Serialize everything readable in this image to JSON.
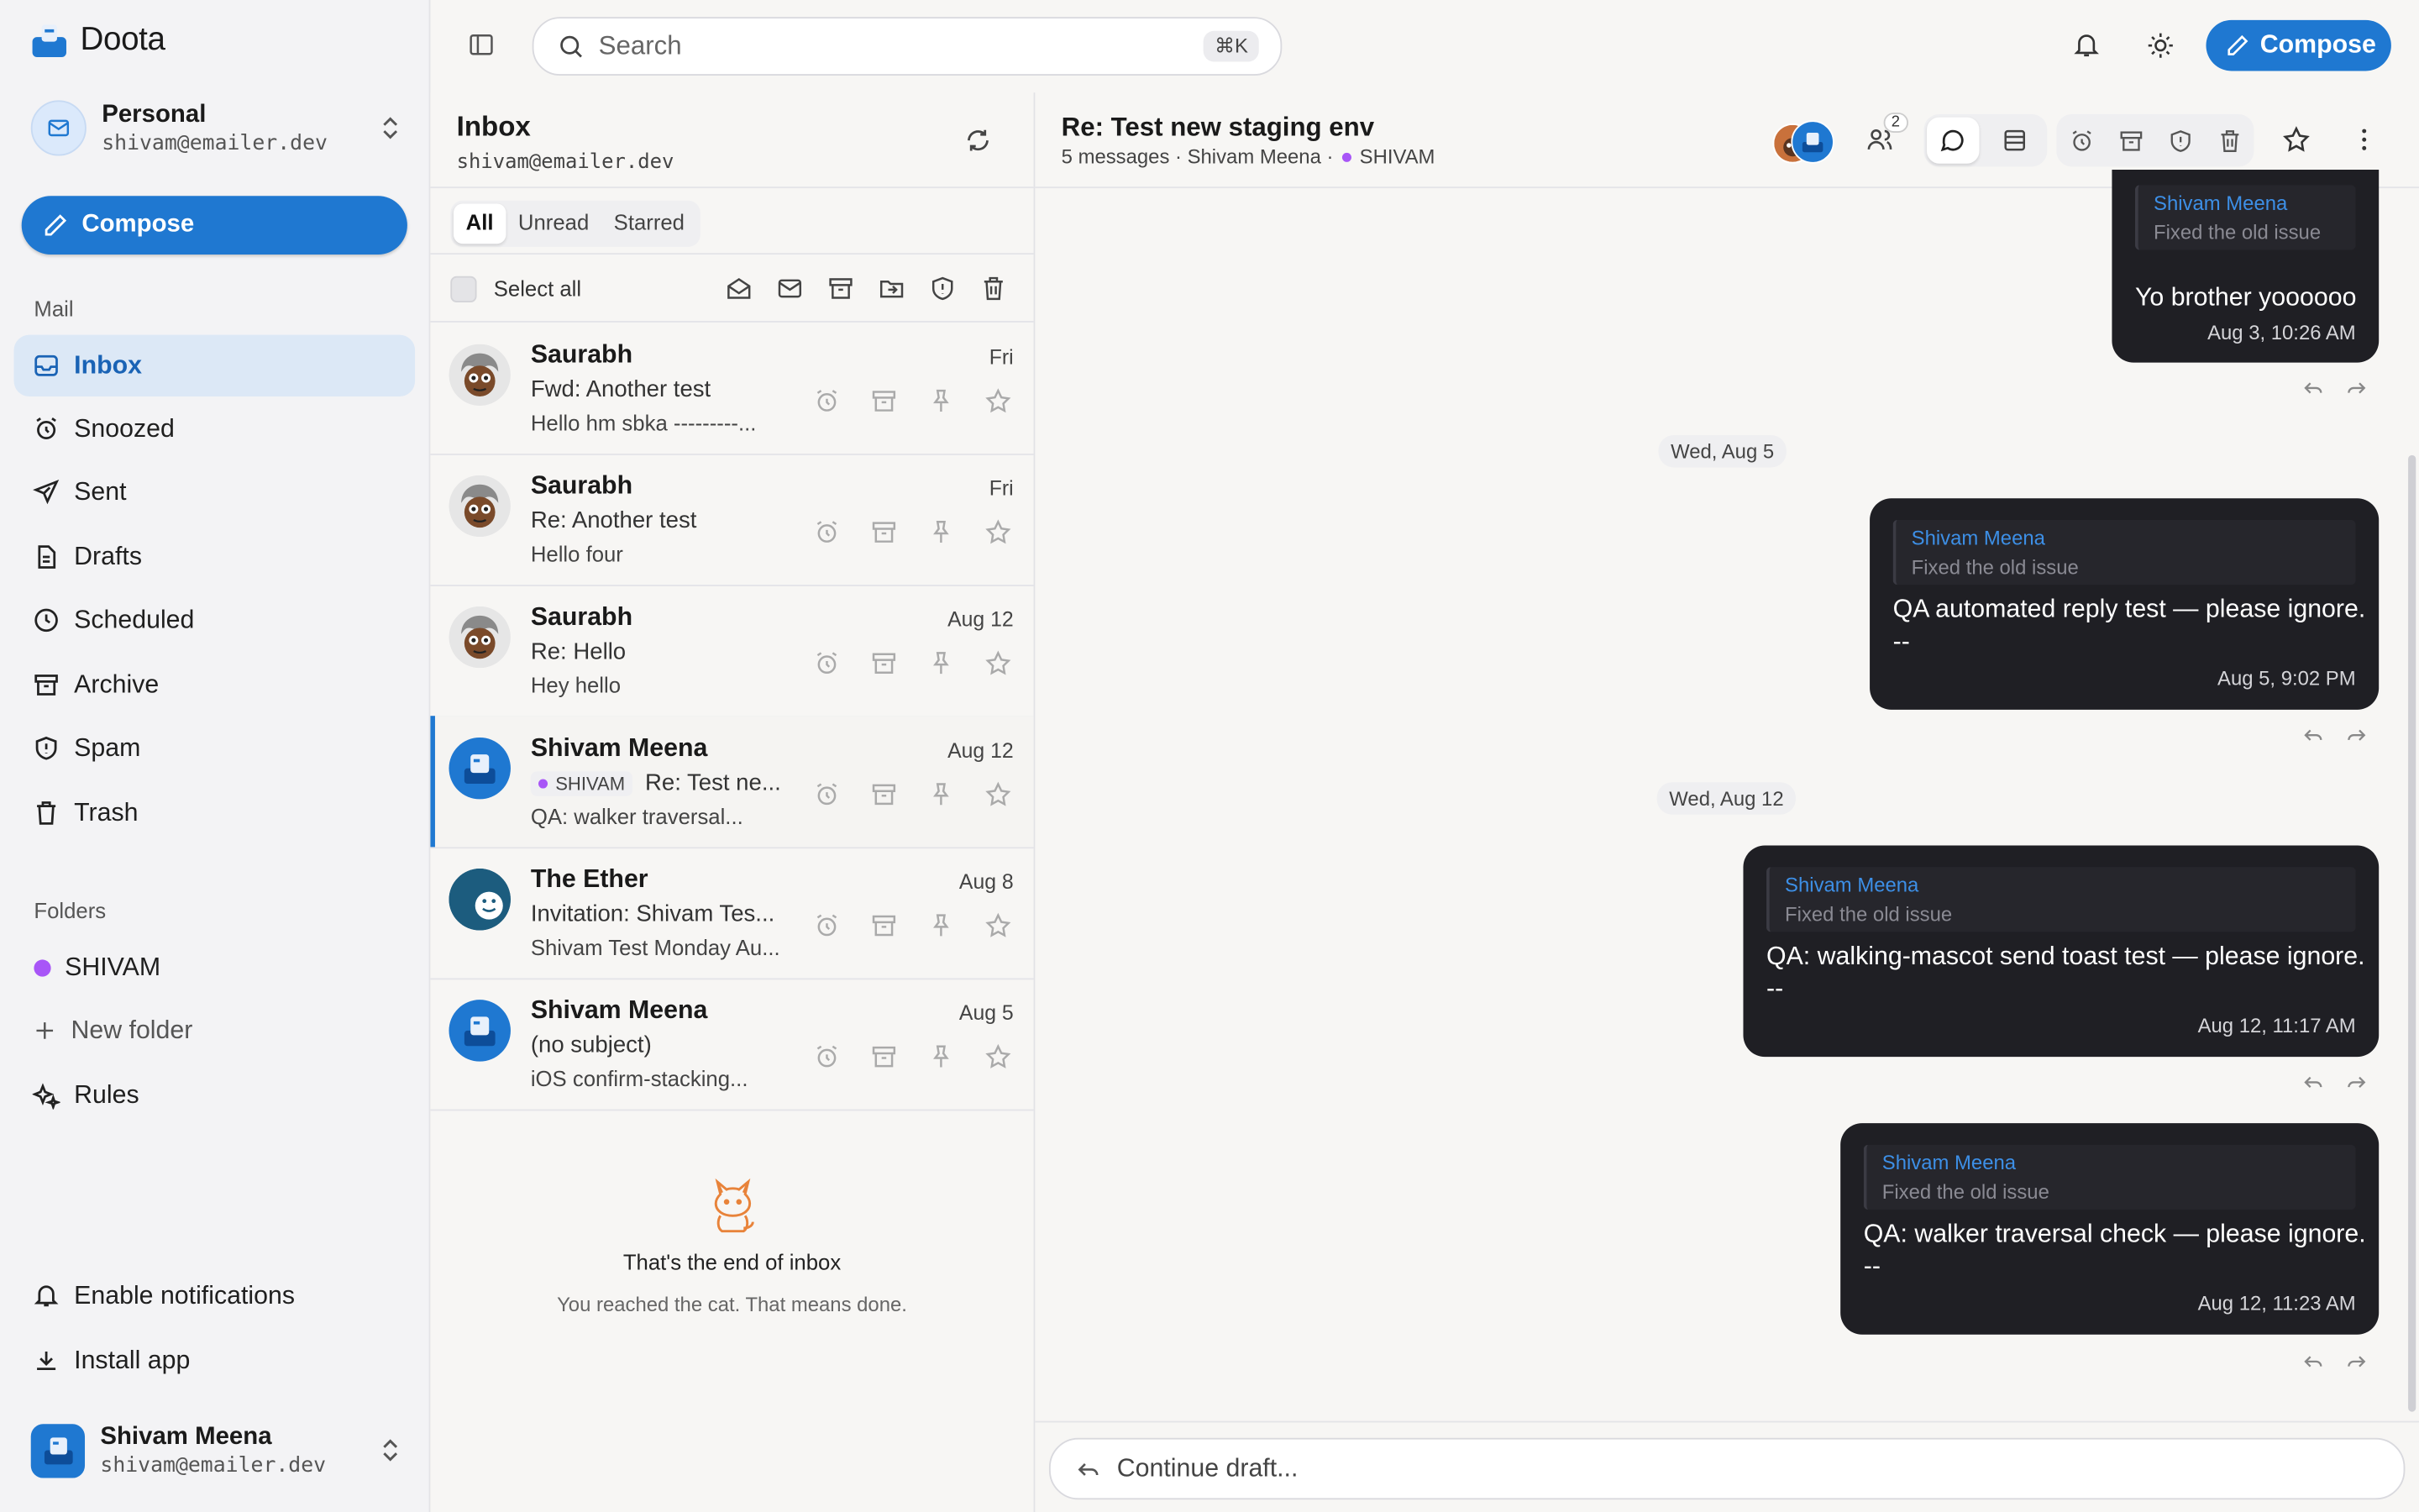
{
  "sidebar": {
    "brand": "Doota",
    "account": {
      "name": "Personal",
      "email": "shivam@emailer.dev"
    },
    "compose_label": "Compose",
    "mail_label": "Mail",
    "items": [
      {
        "label": "Inbox",
        "icon": "inbox-icon",
        "active": true
      },
      {
        "label": "Snoozed",
        "icon": "alarm-icon"
      },
      {
        "label": "Sent",
        "icon": "send-icon"
      },
      {
        "label": "Drafts",
        "icon": "file-icon"
      },
      {
        "label": "Scheduled",
        "icon": "clock-icon"
      },
      {
        "label": "Archive",
        "icon": "archive-icon"
      },
      {
        "label": "Spam",
        "icon": "shield-icon"
      },
      {
        "label": "Trash",
        "icon": "trash-icon"
      }
    ],
    "folders_label": "Folders",
    "folders": [
      {
        "label": "SHIVAM",
        "color": "#a855f7"
      }
    ],
    "new_folder_label": "New folder",
    "rules_label": "Rules",
    "enable_notifications_label": "Enable notifications",
    "install_app_label": "Install app",
    "user": {
      "name": "Shivam Meena",
      "email": "shivam@emailer.dev"
    }
  },
  "topbar": {
    "search_placeholder": "Search",
    "shortcut": "⌘K",
    "compose_label": "Compose"
  },
  "list": {
    "title": "Inbox",
    "email": "shivam@emailer.dev",
    "tabs": [
      "All",
      "Unread",
      "Starred"
    ],
    "select_all_label": "Select all",
    "rows": [
      {
        "sender": "Saurabh",
        "date": "Fri",
        "subject": "Fwd: Another test",
        "preview": "Hello hm sbka ---------...",
        "avatar": "cartoon"
      },
      {
        "sender": "Saurabh",
        "date": "Fri",
        "subject": "Re: Another test",
        "preview": "Hello four",
        "avatar": "cartoon"
      },
      {
        "sender": "Saurabh",
        "date": "Aug 12",
        "subject": "Re: Hello",
        "preview": "Hey hello",
        "avatar": "cartoon"
      },
      {
        "sender": "Shivam Meena",
        "date": "Aug 12",
        "tag": "SHIVAM",
        "subject": "Re: Test ne...",
        "preview": "QA: walker traversal...",
        "avatar": "blue",
        "selected": true
      },
      {
        "sender": "The Ether",
        "date": "Aug 8",
        "subject": "Invitation: Shivam Tes...",
        "preview": "Shivam Test Monday Au...",
        "avatar": "teal"
      },
      {
        "sender": "Shivam Meena",
        "date": "Aug 5",
        "subject": "(no subject)",
        "preview": "iOS confirm-stacking...",
        "avatar": "blue"
      }
    ],
    "end_title": "That's the end of inbox",
    "end_subtitle": "You reached the cat. That means done."
  },
  "thread": {
    "subject": "Re: Test new staging env",
    "meta": "5 messages · Shivam Meena ·",
    "tag": "SHIVAM",
    "participants_count": "2",
    "quote_name": "Shivam Meena",
    "quote_text": "Fixed the old issue",
    "messages": [
      {
        "body": "Yo brother yoooooo",
        "time": "Aug 3, 10:26 AM"
      },
      {
        "body": "QA automated reply test — please ignore.\n--",
        "time": "Aug 5, 9:02 PM"
      },
      {
        "body": "QA: walking-mascot send toast test — please ignore.\n--",
        "time": "Aug 12, 11:17 AM"
      },
      {
        "body": "QA: walker traversal check — please ignore.\n--",
        "time": "Aug 12, 11:23 AM"
      }
    ],
    "date_dividers": [
      "Wed, Aug 5",
      "Wed, Aug 12"
    ],
    "draft_placeholder": "Continue draft..."
  },
  "colors": {
    "accent": "#1f78d1",
    "folder_shivam": "#a855f7",
    "bubble": "#1f1f24"
  }
}
